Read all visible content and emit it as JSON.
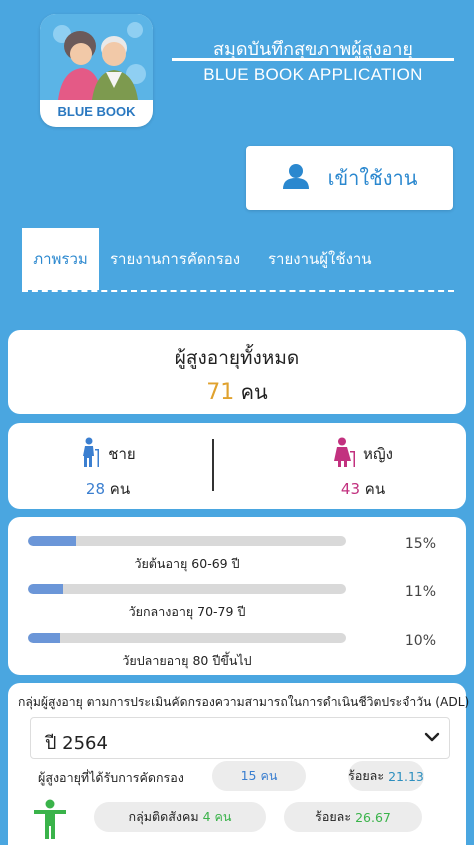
{
  "header": {
    "logo_text": "BLUE BOOK",
    "title_th": "สมุดบันทึกสุขภาพผู้สูงอายุ",
    "title_en": "BLUE BOOK APPLICATION"
  },
  "login": {
    "label": "เข้าใช้งาน",
    "icon": "user-icon"
  },
  "tabs": [
    {
      "label": "ภาพรวม",
      "active": true
    },
    {
      "label": "รายงานการคัดกรอง",
      "active": false
    },
    {
      "label": "รายงานผู้ใช้งาน",
      "active": false
    }
  ],
  "total": {
    "title": "ผู้สูงอายุทั้งหมด",
    "count": "71",
    "unit": "คน"
  },
  "gender": {
    "male": {
      "label": "ชาย",
      "count": "28",
      "unit": "คน",
      "icon": "elderly-man-icon"
    },
    "female": {
      "label": "หญิง",
      "count": "43",
      "unit": "คน",
      "icon": "elderly-woman-icon"
    }
  },
  "age_groups": [
    {
      "label": "วัยต้นอายุ 60-69 ปี",
      "percent": "15%",
      "fraction": 0.15
    },
    {
      "label": "วัยกลางอายุ 70-79 ปี",
      "percent": "11%",
      "fraction": 0.11
    },
    {
      "label": "วัยปลายอายุ 80 ปีขึ้นไป",
      "percent": "10%",
      "fraction": 0.1
    }
  ],
  "adl": {
    "title": "กลุ่มผู้สูงอายุ ตามการประเมินคัดกรองความสามารถในการดำเนินชีวิตประจำวัน (ADL)",
    "year_selected": "ปี 2564",
    "screened_label": "ผู้สูงอายุที่ได้รับการคัดกรอง",
    "screened_count": "15 คน",
    "pct_label": "ร้อยละ",
    "screened_pct": "21.13",
    "social_label": "กลุ่มติดสังคม",
    "social_count": "4 คน",
    "social_pct": "26.67",
    "icon": "standing-person-icon"
  },
  "colors": {
    "background": "#4aa6e0",
    "accent_blue": "#2b88cf",
    "total_number": "#e0a22e",
    "male": "#3b7fd0",
    "female": "#c2317f",
    "social_green": "#3ab34a",
    "bar_fill": "#6b96d8"
  }
}
